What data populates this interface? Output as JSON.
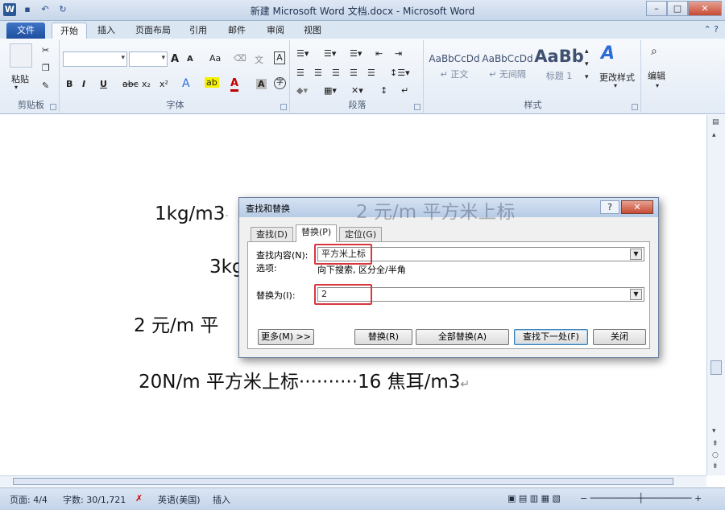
{
  "window": {
    "title": "新建 Microsoft Word 文档.docx - Microsoft Word"
  },
  "tabs": [
    "文件",
    "开始",
    "插入",
    "页面布局",
    "引用",
    "邮件",
    "审阅",
    "视图"
  ],
  "ribbon": {
    "clipboard": {
      "label": "剪贴板",
      "paste": "粘贴"
    },
    "font": {
      "label": "字体",
      "bold": "B",
      "italic": "I",
      "underline": "U",
      "strike": "abc",
      "sub": "x₂",
      "sup": "x²",
      "grow": "A",
      "shrink": "A",
      "aa": "Aa",
      "clear": "A"
    },
    "paragraph": {
      "label": "段落"
    },
    "styles": {
      "label": "样式",
      "items": [
        {
          "sample": "AaBbCcDd",
          "name": "↵ 正文"
        },
        {
          "sample": "AaBbCcDd",
          "name": "↵ 无间隔"
        },
        {
          "sample": "AaBb",
          "name": "标题 1"
        }
      ],
      "change": "更改样式"
    },
    "editing": {
      "label": "编辑"
    }
  },
  "document": {
    "lines": [
      "1kg/m3",
      "3kg",
      "2 元/m 平",
      "20N/m 平方米上标··········16 焦耳/m3"
    ],
    "ghost": "2 元/m 平方米上标"
  },
  "dialog": {
    "title": "查找和替换",
    "help": "?",
    "close": "✕",
    "tabs": [
      "查找(D)",
      "替换(P)",
      "定位(G)"
    ],
    "find_label": "查找内容(N):",
    "find_value": "平方米上标",
    "options_label": "选项:",
    "options_value": "向下搜索, 区分全/半角",
    "replace_label": "替换为(I):",
    "replace_value": "2",
    "buttons": {
      "more": "更多(M) >>",
      "replace": "替换(R)",
      "replace_all": "全部替换(A)",
      "find_next": "查找下一处(F)",
      "close": "关闭"
    }
  },
  "status": {
    "page": "页面: 4/4",
    "words": "字数: 30/1,721",
    "language": "英语(美国)",
    "mode": "插入"
  },
  "colors": {
    "accent": "#2b5797",
    "highlight": "#d9363e"
  }
}
